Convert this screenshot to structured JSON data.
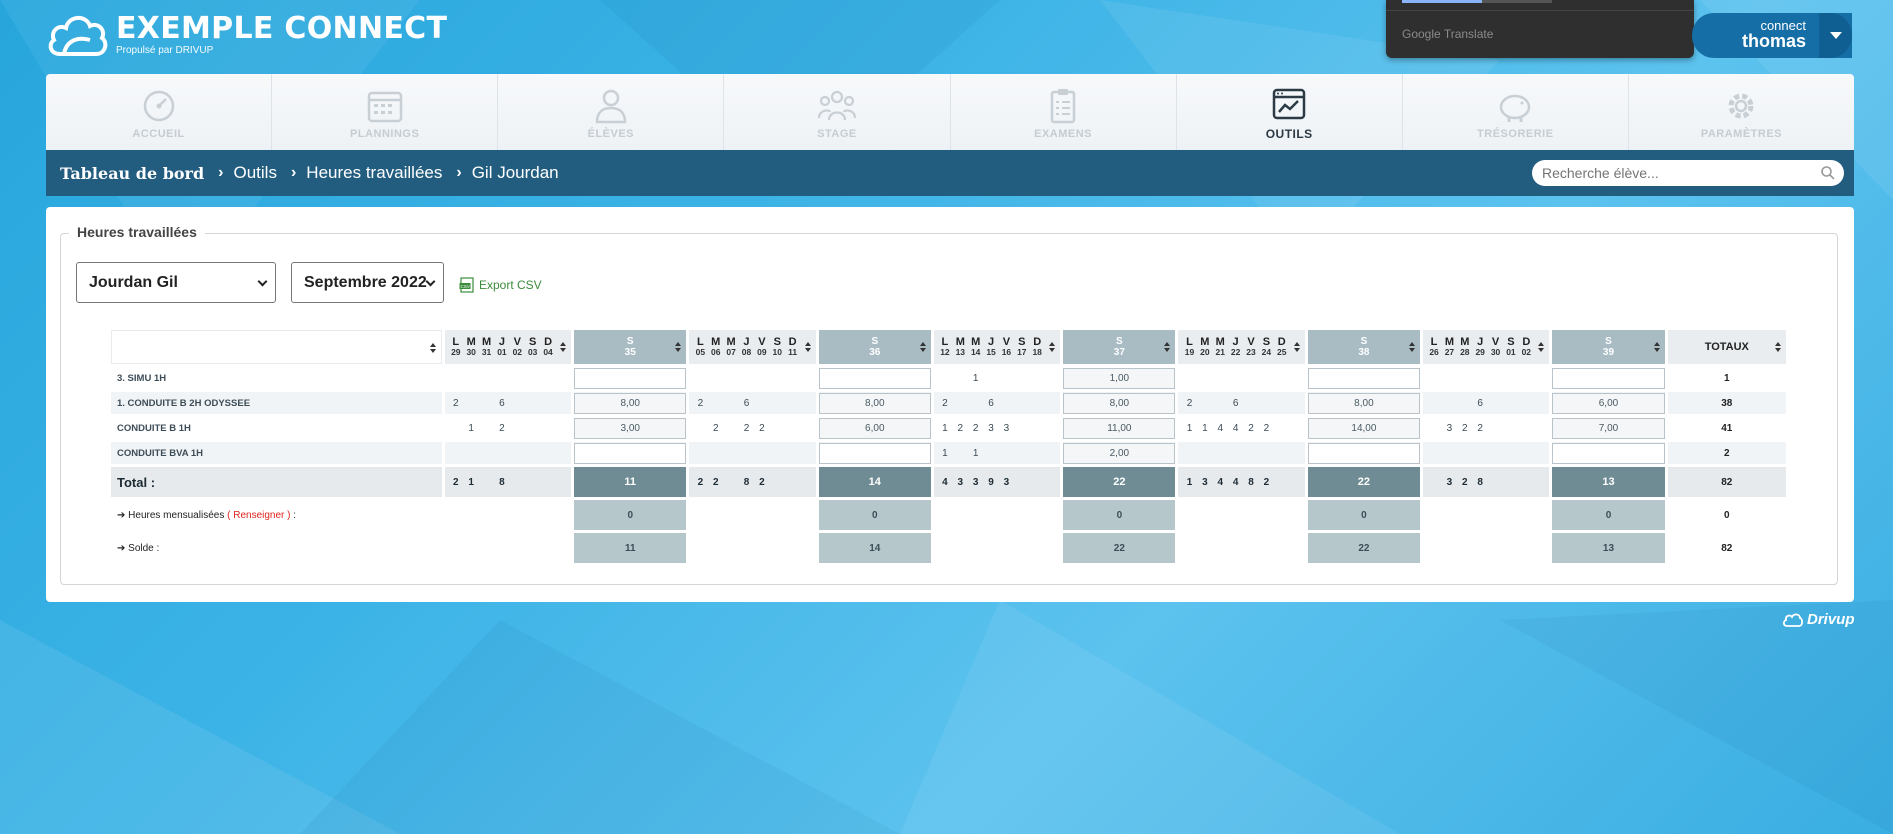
{
  "app": {
    "title": "EXEMPLE CONNECT",
    "subtitle": "Propulsé par DRIVUP"
  },
  "google_translate": {
    "label": "Google Translate"
  },
  "user": {
    "connect_label": "connect",
    "name": "thomas"
  },
  "nav": [
    {
      "label": "ACCUEIL",
      "icon": "gauge-icon",
      "active": false
    },
    {
      "label": "PLANNINGS",
      "icon": "calendar-icon",
      "active": false
    },
    {
      "label": "ÉLÈVES",
      "icon": "student-icon",
      "active": false
    },
    {
      "label": "STAGE",
      "icon": "group-icon",
      "active": false
    },
    {
      "label": "EXAMENS",
      "icon": "clipboard-icon",
      "active": false
    },
    {
      "label": "OUTILS",
      "icon": "tools-window-icon",
      "active": true
    },
    {
      "label": "TRÉSORERIE",
      "icon": "piggy-bank-icon",
      "active": false
    },
    {
      "label": "PARAMÈTRES",
      "icon": "gear-icon",
      "active": false
    }
  ],
  "breadcrumb": [
    "Tableau de bord",
    "Outils",
    "Heures travaillées",
    "Gil Jourdan"
  ],
  "search": {
    "placeholder": "Recherche élève...",
    "value": ""
  },
  "panel": {
    "legend": "Heures travaillées",
    "student_select": "Jourdan Gil",
    "month_select": "Septembre 2022",
    "export_label": "Export CSV"
  },
  "table": {
    "day_letters": [
      "L",
      "M",
      "M",
      "J",
      "V",
      "S",
      "D"
    ],
    "totals_header": "TOTAUX",
    "weeks": [
      {
        "header_s": "S",
        "header_num": "35",
        "dates": [
          "29",
          "30",
          "31",
          "01",
          "02",
          "03",
          "04"
        ]
      },
      {
        "header_s": "S",
        "header_num": "36",
        "dates": [
          "05",
          "06",
          "07",
          "08",
          "09",
          "10",
          "11"
        ]
      },
      {
        "header_s": "S",
        "header_num": "37",
        "dates": [
          "12",
          "13",
          "14",
          "15",
          "16",
          "17",
          "18"
        ]
      },
      {
        "header_s": "S",
        "header_num": "38",
        "dates": [
          "19",
          "20",
          "21",
          "22",
          "23",
          "24",
          "25"
        ]
      },
      {
        "header_s": "S",
        "header_num": "39",
        "dates": [
          "26",
          "27",
          "28",
          "29",
          "30",
          "01",
          "02"
        ]
      }
    ],
    "rows": [
      {
        "label": "3. SIMU 1H",
        "days": [
          [
            "",
            "",
            "",
            "",
            "",
            "",
            ""
          ],
          [
            "",
            "",
            "",
            "",
            "",
            "",
            ""
          ],
          [
            "",
            "",
            "1",
            "",
            "",
            "",
            ""
          ],
          [
            "",
            "",
            "",
            "",
            "",
            "",
            ""
          ],
          [
            "",
            "",
            "",
            "",
            "",
            "",
            ""
          ]
        ],
        "weeks": [
          "",
          "",
          "1,00",
          "",
          ""
        ],
        "total": "1"
      },
      {
        "label": "1. CONDUITE B 2H ODYSSEE",
        "days": [
          [
            "2",
            "",
            "",
            "6",
            "",
            "",
            ""
          ],
          [
            "2",
            "",
            "",
            "6",
            "",
            "",
            ""
          ],
          [
            "2",
            "",
            "",
            "6",
            "",
            "",
            ""
          ],
          [
            "2",
            "",
            "",
            "6",
            "",
            "",
            ""
          ],
          [
            "",
            "",
            "",
            "6",
            "",
            "",
            ""
          ]
        ],
        "weeks": [
          "8,00",
          "8,00",
          "8,00",
          "8,00",
          "6,00"
        ],
        "total": "38"
      },
      {
        "label": "CONDUITE B 1H",
        "days": [
          [
            "",
            "1",
            "",
            "2",
            "",
            "",
            ""
          ],
          [
            "",
            "2",
            "",
            "2",
            "2",
            "",
            ""
          ],
          [
            "1",
            "2",
            "2",
            "3",
            "3",
            "",
            ""
          ],
          [
            "1",
            "1",
            "4",
            "4",
            "2",
            "2",
            ""
          ],
          [
            "",
            "3",
            "2",
            "2",
            "",
            "",
            ""
          ]
        ],
        "weeks": [
          "3,00",
          "6,00",
          "11,00",
          "14,00",
          "7,00"
        ],
        "total": "41"
      },
      {
        "label": "CONDUITE BVA 1H",
        "days": [
          [
            "",
            "",
            "",
            "",
            "",
            "",
            ""
          ],
          [
            "",
            "",
            "",
            "",
            "",
            "",
            ""
          ],
          [
            "1",
            "",
            "1",
            "",
            "",
            "",
            ""
          ],
          [
            "",
            "",
            "",
            "",
            "",
            "",
            ""
          ],
          [
            "",
            "",
            "",
            "",
            "",
            "",
            ""
          ]
        ],
        "weeks": [
          "",
          "",
          "2,00",
          "",
          ""
        ],
        "total": "2"
      }
    ],
    "total_row": {
      "label": "Total :",
      "days": [
        [
          "2",
          "1",
          "",
          "8",
          "",
          "",
          ""
        ],
        [
          "2",
          "2",
          "",
          "8",
          "2",
          "",
          ""
        ],
        [
          "4",
          "3",
          "3",
          "9",
          "3",
          "",
          ""
        ],
        [
          "1",
          "3",
          "4",
          "4",
          "8",
          "2",
          ""
        ],
        [
          "",
          "3",
          "2",
          "8",
          "",
          "",
          ""
        ]
      ],
      "weeks": [
        "11",
        "14",
        "22",
        "22",
        "13"
      ],
      "total": "82"
    },
    "monthly_row": {
      "label_prefix": "➔ Heures mensualisées",
      "link": "( Renseigner )",
      "label_suffix": ":",
      "weeks": [
        "0",
        "0",
        "0",
        "0",
        "0"
      ],
      "total": "0"
    },
    "balance_row": {
      "label": "➔ Solde :",
      "weeks": [
        "11",
        "14",
        "22",
        "22",
        "13"
      ],
      "total": "82"
    }
  },
  "footer": {
    "brand": "Drivup"
  }
}
